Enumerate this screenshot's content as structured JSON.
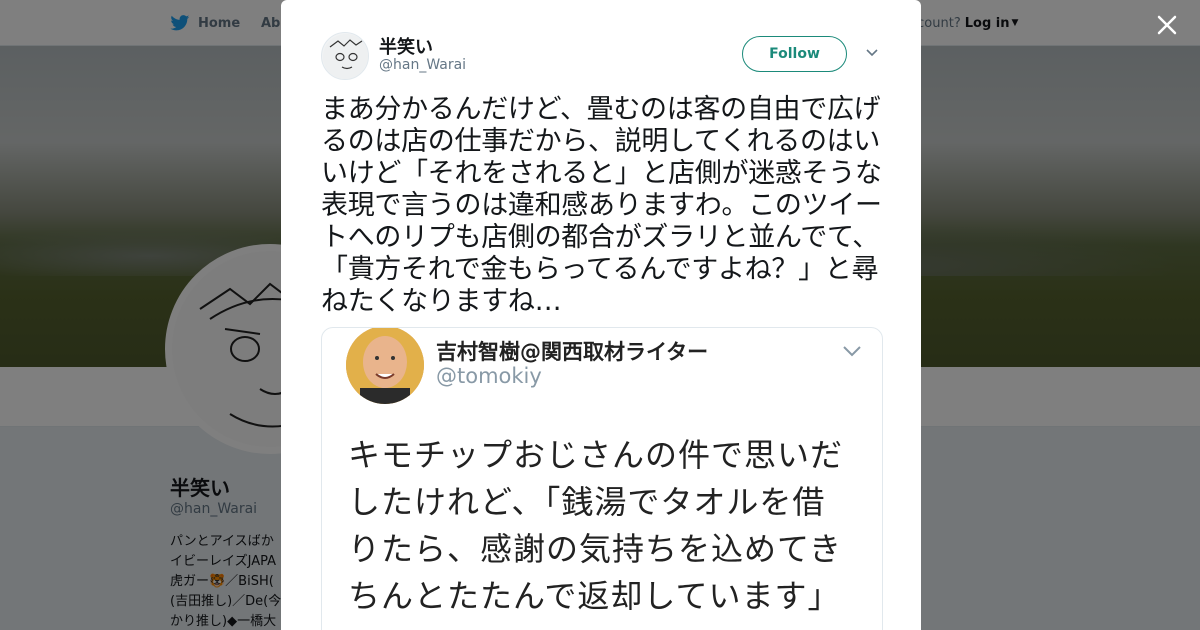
{
  "background_page": {
    "nav": {
      "home_label": "Home",
      "about_label": "Abo",
      "account_prompt": "ccount?",
      "login_label": "Log in"
    },
    "profile": {
      "name": "半笑い",
      "handle": "@han_Warai",
      "bio": "パンとアイスばか イビーレイズJAPA 虎ガー🐯／BiSH( (吉田推し)／De(今 かり推し)◆一橋大"
    }
  },
  "modal": {
    "author": {
      "name": "半笑い",
      "handle": "@han_Warai"
    },
    "follow_label": "Follow",
    "tweet_text": "まあ分かるんだけど、畳むのは客の自由で広げるのは店の仕事だから、説明してくれるのはいいけど「それをされると」と店側が迷惑そうな表現で言うのは違和感ありますわ。このツイートへのリプも店側の都合がズラリと並んでて、「貴方それで金もらってるんですよね？」と尋ねたくなりますね…",
    "embedded_screenshot": {
      "name": "吉村智樹@関西取材ライター",
      "handle": "@tomokiy",
      "text": "キモチップおじさんの件で思いだしたけれど、「銭湯でタオルを借りたら、感謝の気持ちを込めてきちんとたたんで返却しています」"
    }
  },
  "colors": {
    "follow_accent": "#1b8a7a",
    "twitter_blue": "#1da1f2"
  },
  "icons": [
    "twitter-bird-icon",
    "close-icon",
    "chevron-down-icon"
  ]
}
